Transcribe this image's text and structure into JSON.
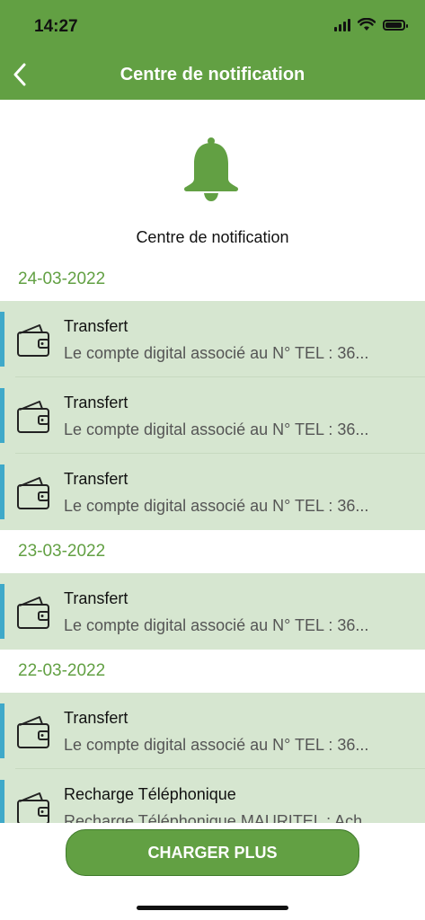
{
  "status_bar": {
    "time": "14:27"
  },
  "header": {
    "title": "Centre de notification"
  },
  "hero": {
    "title": "Centre de notification"
  },
  "groups": [
    {
      "date": "24-03-2022",
      "items": [
        {
          "title": "Transfert",
          "body": "Le compte digital associé au N° TEL : 36..."
        },
        {
          "title": "Transfert",
          "body": "Le compte digital associé au N° TEL : 36..."
        },
        {
          "title": "Transfert",
          "body": "Le compte digital associé au N° TEL : 36..."
        }
      ]
    },
    {
      "date": "23-03-2022",
      "items": [
        {
          "title": "Transfert",
          "body": "Le compte digital associé au N° TEL : 36..."
        }
      ]
    },
    {
      "date": "22-03-2022",
      "items": [
        {
          "title": "Transfert",
          "body": "Le compte digital associé au N° TEL : 36..."
        },
        {
          "title": "Recharge Téléphonique",
          "body": "Recharge Téléphonique MAURITEL : Ach..."
        }
      ]
    }
  ],
  "actions": {
    "load_more_label": "CHARGER PLUS"
  },
  "colors": {
    "primary": "#62a043",
    "item_background": "#d6e6d0",
    "accent_bar": "#3fa9c9"
  }
}
